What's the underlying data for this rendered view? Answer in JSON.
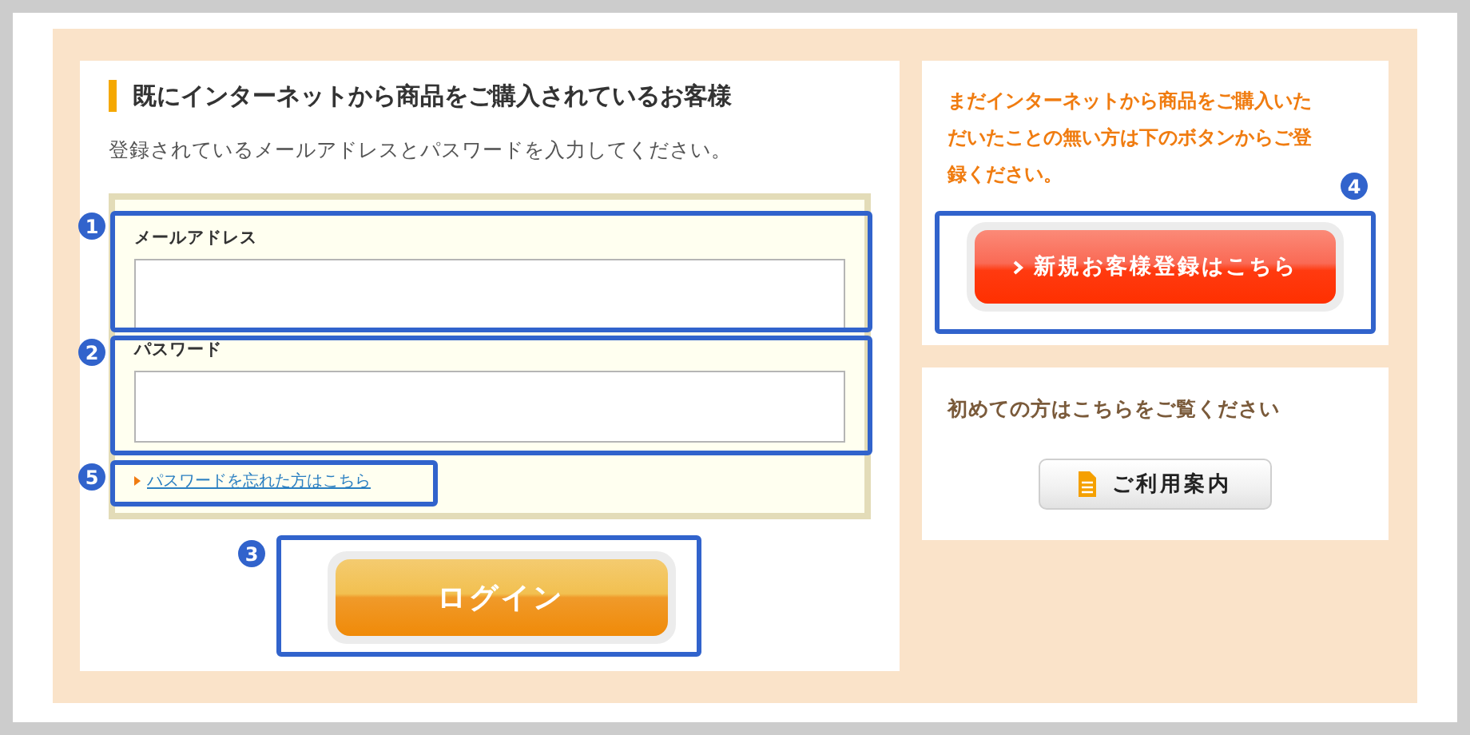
{
  "login_section": {
    "heading": "既にインターネットから商品をご購入されているお客様",
    "instruction": "登録されているメールアドレスとパスワードを入力してください。",
    "fields": [
      {
        "label": "メールアドレス"
      },
      {
        "label": "パスワード"
      }
    ],
    "forgot_link": "パスワードを忘れた方はこちら",
    "login_button": "ログイン"
  },
  "register_section": {
    "message": "まだインターネットから商品をご購入いただいたことの無い方は下のボタンからご登録ください。",
    "button": "新規お客様登録はこちら"
  },
  "guide_section": {
    "heading": "初めての方はこちらをご覧ください",
    "button": "ご利用案内"
  },
  "annotations": [
    {
      "number": "1"
    },
    {
      "number": "2"
    },
    {
      "number": "5"
    },
    {
      "number": "3"
    },
    {
      "number": "4"
    }
  ]
}
